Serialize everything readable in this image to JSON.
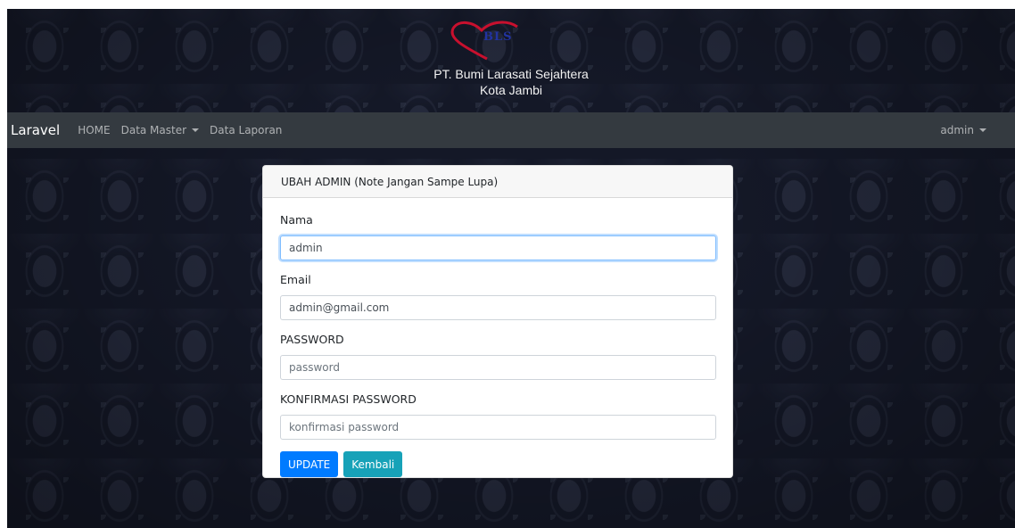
{
  "banner": {
    "logo_text": "BLS",
    "company": "PT. Bumi Larasati Sejahtera",
    "city": "Kota Jambi"
  },
  "navbar": {
    "brand": "Laravel",
    "items": [
      {
        "label": "HOME"
      },
      {
        "label": "Data Master"
      },
      {
        "label": "Data Laporan"
      }
    ],
    "user": "admin"
  },
  "form": {
    "title": "UBAH ADMIN (Note Jangan Sampe Lupa)",
    "fields": [
      {
        "label": "Nama",
        "value": "admin",
        "placeholder": ""
      },
      {
        "label": "Email",
        "value": "admin@gmail.com",
        "placeholder": ""
      },
      {
        "label": "PASSWORD",
        "value": "",
        "placeholder": "password"
      },
      {
        "label": "KONFIRMASI PASSWORD",
        "value": "",
        "placeholder": "konfirmasi password"
      }
    ],
    "update_label": "UPDATE",
    "back_label": "Kembali"
  },
  "colors": {
    "navbar": "#343a40",
    "primary": "#007bff",
    "info": "#17a2b8",
    "logo_heart": "#c8102e"
  }
}
